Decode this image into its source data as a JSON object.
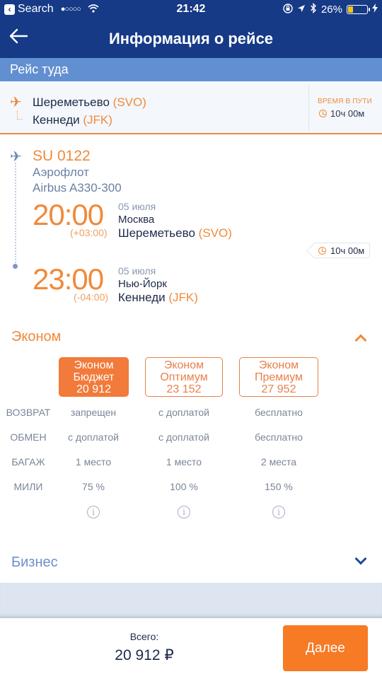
{
  "status_bar": {
    "back_app": "Search",
    "signal": "●○○○○",
    "time": "21:42",
    "battery": "26%",
    "battery_level": 0.26
  },
  "nav": {
    "back_icon": "←",
    "title": "Информация о рейсе"
  },
  "section_title": "Рейс туда",
  "route_summary": {
    "from_name": "Шереметьево",
    "from_code": "(SVO)",
    "to_name": "Кеннеди",
    "to_code": "(JFK)",
    "duration_label": "ВРЕМЯ В ПУТИ",
    "duration": "10ч 00м"
  },
  "flight": {
    "number": "SU 0122",
    "airline": "Аэрофлот",
    "aircraft": "Airbus A330-300",
    "departure": {
      "time": "20:00",
      "tz": "(+03:00)",
      "date": "05 июля",
      "city": "Москва",
      "airport": "Шереметьево",
      "code": "(SVO)"
    },
    "duration": "10ч 00м",
    "arrival": {
      "time": "23:00",
      "tz": "(-04:00)",
      "date": "05 июля",
      "city": "Нью-Йорк",
      "airport": "Кеннеди",
      "code": "(JFK)"
    }
  },
  "economy": {
    "title": "Эконом",
    "expanded": true,
    "fares": [
      {
        "line1": "Эконом",
        "line2": "Бюджет",
        "price": "20 912",
        "selected": true
      },
      {
        "line1": "Эконом",
        "line2": "Оптимум",
        "price": "23 152",
        "selected": false
      },
      {
        "line1": "Эконом",
        "line2": "Премиум",
        "price": "27 952",
        "selected": false
      }
    ],
    "rows": [
      {
        "label": "ВОЗВРАТ",
        "values": [
          "запрещен",
          "с доплатой",
          "бесплатно"
        ]
      },
      {
        "label": "ОБМЕН",
        "values": [
          "с доплатой",
          "с доплатой",
          "бесплатно"
        ]
      },
      {
        "label": "БАГАЖ",
        "values": [
          "1 место",
          "1 место",
          "2 места"
        ]
      },
      {
        "label": "МИЛИ",
        "values": [
          "75 %",
          "100 %",
          "150 %"
        ]
      }
    ],
    "info_icon": "i"
  },
  "business": {
    "title": "Бизнес",
    "expanded": false
  },
  "footer": {
    "total_label": "Всего:",
    "total": "20 912 ₽",
    "next_label": "Далее"
  },
  "colors": {
    "brand_navy": "#163a86",
    "section_blue": "#628fd0",
    "accent_orange": "#f27a3a"
  }
}
